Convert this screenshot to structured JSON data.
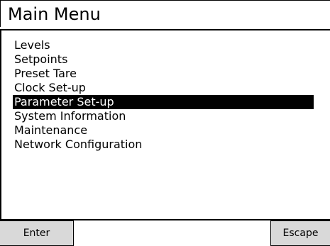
{
  "title": "Main Menu",
  "menu": {
    "items": [
      {
        "label": "Levels"
      },
      {
        "label": "Setpoints"
      },
      {
        "label": "Preset Tare"
      },
      {
        "label": "Clock Set-up"
      },
      {
        "label": "Parameter Set-up",
        "selected": true
      },
      {
        "label": "System Information"
      },
      {
        "label": "Maintenance"
      },
      {
        "label": "Network Configuration"
      }
    ]
  },
  "buttons": {
    "enter_label": "Enter",
    "escape_label": "Escape"
  },
  "colors": {
    "selection_bg": "#000000",
    "selection_fg": "#ffffff",
    "button_bg": "#d9d9d9"
  }
}
